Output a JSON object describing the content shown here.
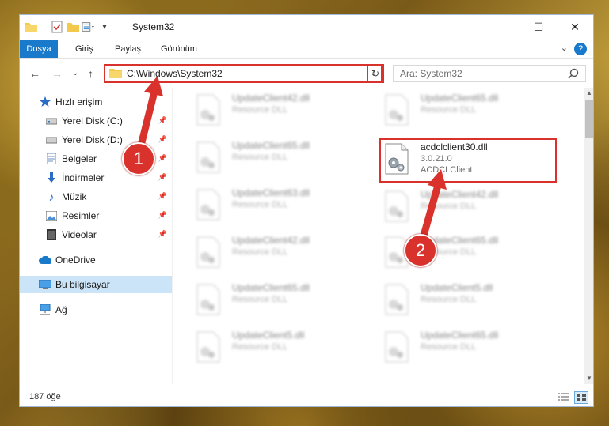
{
  "window": {
    "title": "System32"
  },
  "ribbon": {
    "tabs": [
      "Dosya",
      "Giriş",
      "Paylaş",
      "Görünüm"
    ]
  },
  "address": {
    "path": "C:\\Windows\\System32"
  },
  "search": {
    "placeholder": "Ara: System32"
  },
  "sidebar": {
    "items": [
      {
        "label": "Hızlı erişim",
        "icon": "star-icon",
        "pinned": false
      },
      {
        "label": "Yerel Disk (C:)",
        "icon": "drive-icon",
        "pinned": true
      },
      {
        "label": "Yerel Disk (D:)",
        "icon": "drive-icon",
        "pinned": true
      },
      {
        "label": "Belgeler",
        "icon": "documents-icon",
        "pinned": true
      },
      {
        "label": "İndirmeler",
        "icon": "download-icon",
        "pinned": true
      },
      {
        "label": "Müzik",
        "icon": "music-icon",
        "pinned": true
      },
      {
        "label": "Resimler",
        "icon": "pictures-icon",
        "pinned": true
      },
      {
        "label": "Videolar",
        "icon": "video-icon",
        "pinned": true
      },
      {
        "label": "OneDrive",
        "icon": "cloud-icon",
        "pinned": false
      },
      {
        "label": "Bu bilgisayar",
        "icon": "computer-icon",
        "pinned": false,
        "selected": true
      },
      {
        "label": "Ağ",
        "icon": "network-icon",
        "pinned": false
      }
    ]
  },
  "files": {
    "left": [
      {
        "name": "UpdateClient42.dll",
        "type": "Resource DLL"
      },
      {
        "name": "UpdateClient65.dll",
        "type": "Resource DLL"
      },
      {
        "name": "UpdateClient63.dll",
        "type": "Resource DLL"
      },
      {
        "name": "UpdateClient42.dll",
        "type": "Resource DLL"
      },
      {
        "name": "UpdateClient65.dll",
        "type": "Resource DLL"
      },
      {
        "name": "UpdateClient5.dll",
        "type": "Resource DLL"
      }
    ],
    "right": [
      {
        "name": "UpdateClient65.dll",
        "type": "Resource DLL"
      },
      {
        "name": "UpdateClient42.dll",
        "type": "Resource DLL"
      },
      {
        "name": "UpdateClient65.dll",
        "type": "Resource DLL"
      },
      {
        "name": "UpdateClient5.dll",
        "type": "Resource DLL"
      },
      {
        "name": "UpdateClient65.dll",
        "type": "Resource DLL"
      }
    ],
    "featured": {
      "name": "acdclclient30.dll",
      "version": "3.0.21.0",
      "company": "ACDCLClient"
    }
  },
  "status": {
    "count": "187 öğe"
  },
  "annotations": {
    "step1": "1",
    "step2": "2"
  },
  "colors": {
    "accent": "#1979ca",
    "highlight": "#d9312b",
    "selected": "#cce4f7"
  }
}
